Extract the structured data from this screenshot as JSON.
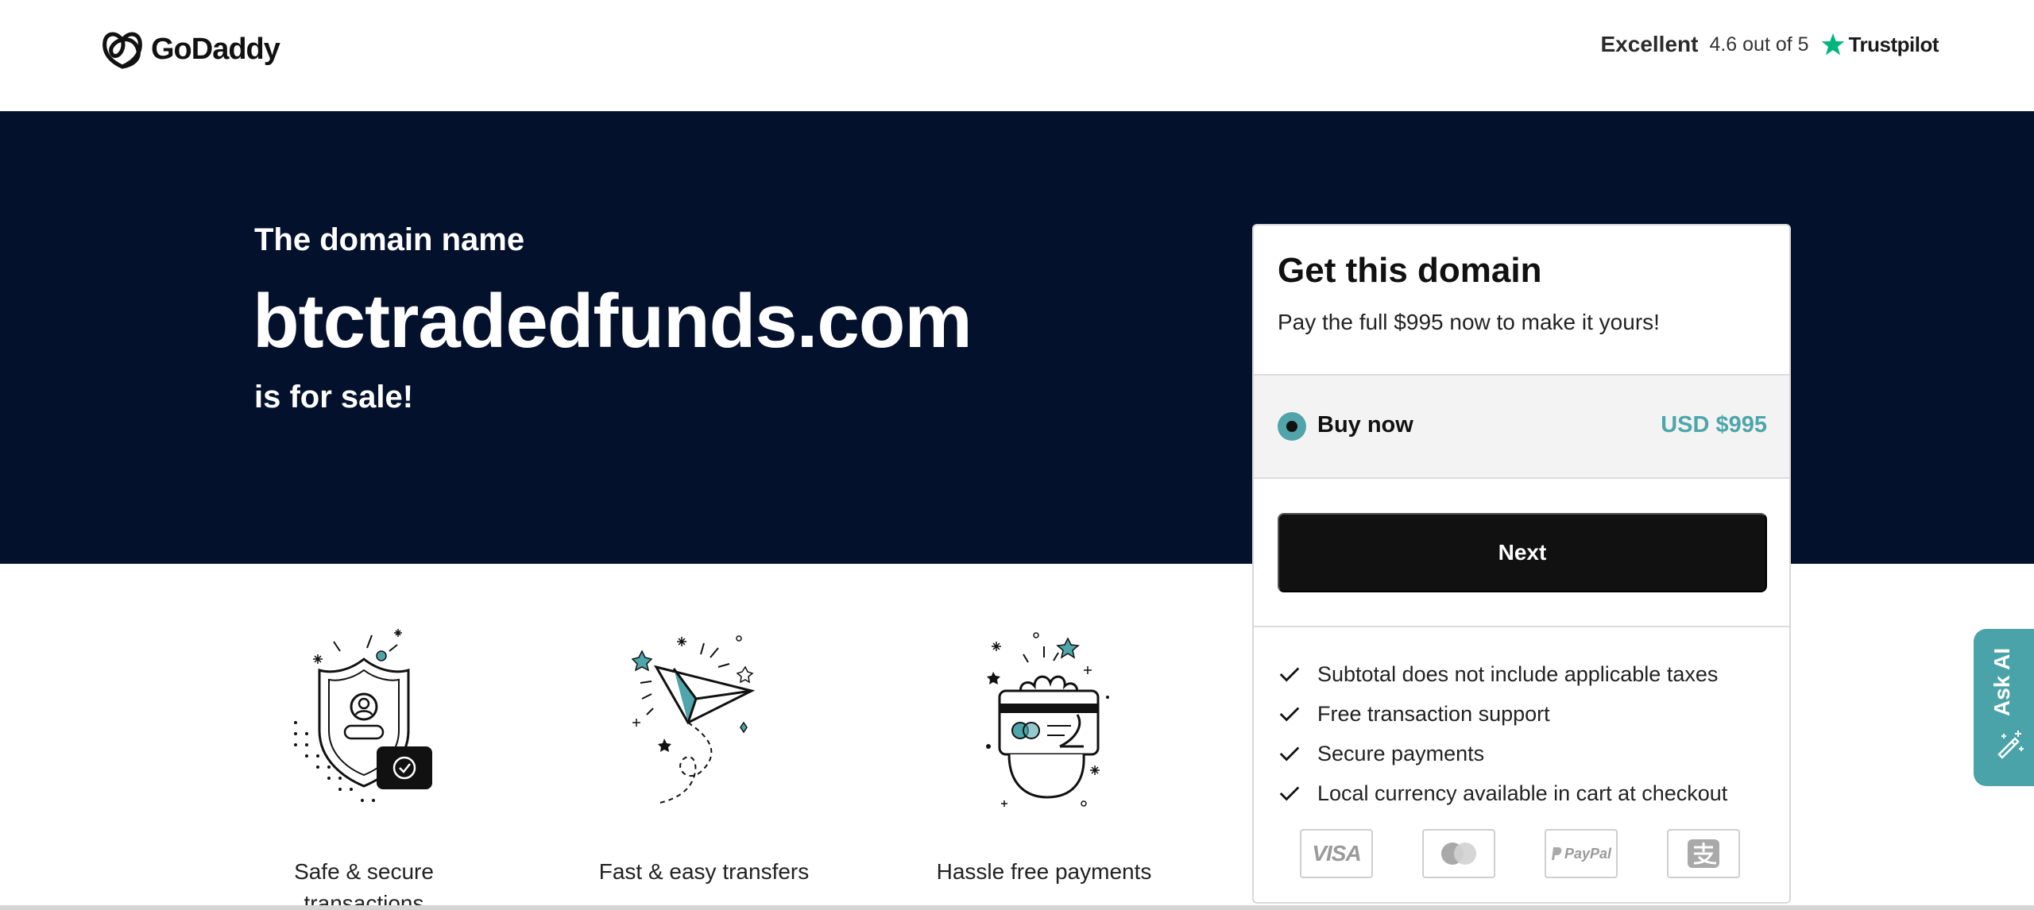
{
  "header": {
    "logo_text": "GoDaddy",
    "trust_rating_label": "Excellent",
    "trust_score": "4.6 out of 5",
    "trust_brand": "Trustpilot"
  },
  "hero": {
    "pre_text": "The domain name",
    "domain": "btctradedfunds.com",
    "post_text": "is for sale!"
  },
  "card": {
    "title": "Get this domain",
    "subtitle": "Pay the full $995 now to make it yours!",
    "option_label": "Buy now",
    "option_price": "USD $995",
    "next_label": "Next",
    "features": [
      "Subtotal does not include applicable taxes",
      "Free transaction support",
      "Secure payments",
      "Local currency available in cart at checkout"
    ],
    "payment_methods": {
      "visa": "VISA",
      "paypal": "PayPal"
    }
  },
  "features": [
    {
      "label": "Safe & secure transactions",
      "icon": "shield-icon"
    },
    {
      "label": "Fast & easy transfers",
      "icon": "paper-plane-icon"
    },
    {
      "label": "Hassle free payments",
      "icon": "card-hand-icon"
    }
  ],
  "ask_ai": {
    "label": "Ask AI"
  },
  "colors": {
    "hero_bg": "#03112d",
    "accent": "#4ea6ab",
    "button_bg": "#111111"
  }
}
